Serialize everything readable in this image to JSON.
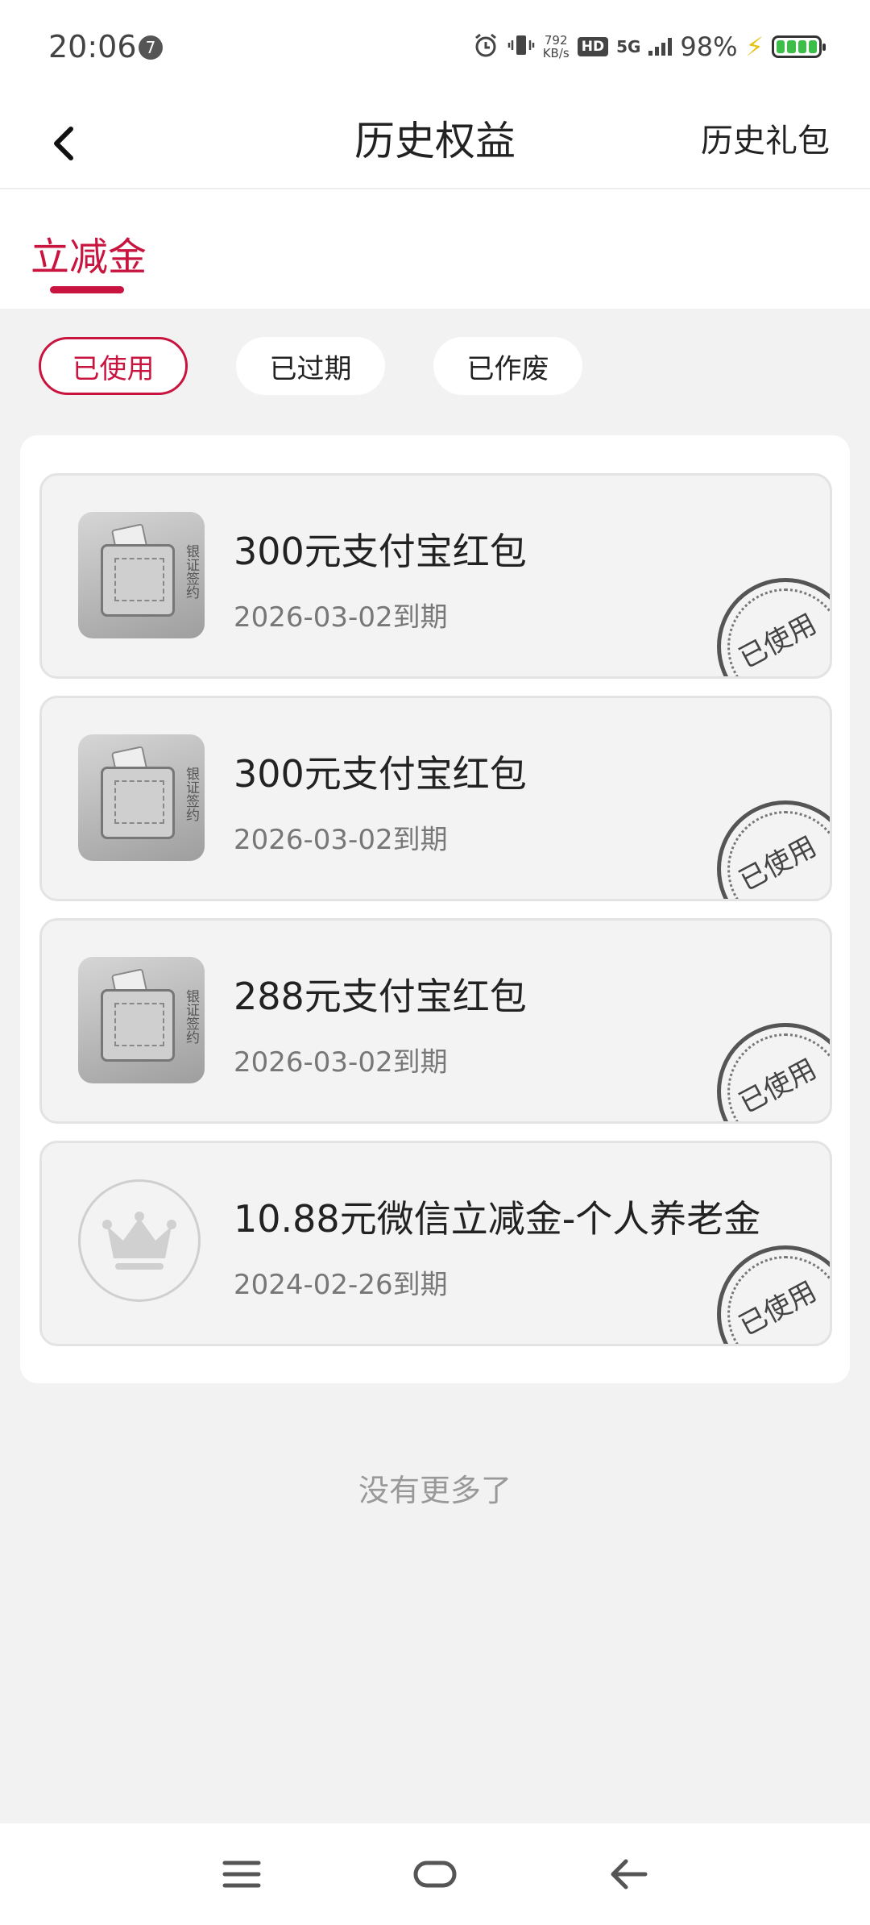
{
  "status_bar": {
    "time": "20:06",
    "notification_count": "7",
    "net_speed_value": "792",
    "net_speed_unit": "KB/s",
    "hd_label": "HD",
    "network_type": "5G",
    "battery_percent": "98%"
  },
  "header": {
    "title": "历史权益",
    "right_link": "历史礼包"
  },
  "tabs": [
    {
      "label": "立减金",
      "active": true
    }
  ],
  "filters": [
    {
      "label": "已使用",
      "active": true
    },
    {
      "label": "已过期",
      "active": false
    },
    {
      "label": "已作废",
      "active": false
    }
  ],
  "coupons": [
    {
      "title": "300元支付宝红包",
      "expiry": "2026-03-02到期",
      "status": "已使用",
      "icon": "wallet-bag-image",
      "icon_text": "银证签约"
    },
    {
      "title": "300元支付宝红包",
      "expiry": "2026-03-02到期",
      "status": "已使用",
      "icon": "wallet-bag-image",
      "icon_text": "银证签约"
    },
    {
      "title": "288元支付宝红包",
      "expiry": "2026-03-02到期",
      "status": "已使用",
      "icon": "wallet-bag-image",
      "icon_text": "银证签约"
    },
    {
      "title": "10.88元微信立减金-个人养老金",
      "expiry": "2024-02-26到期",
      "status": "已使用",
      "icon": "crown-icon"
    }
  ],
  "footer_text": "没有更多了",
  "colors": {
    "accent": "#c8143f",
    "background": "#f2f2f2",
    "card_bg": "#f3f3f3",
    "battery_green": "#3dbe49"
  }
}
